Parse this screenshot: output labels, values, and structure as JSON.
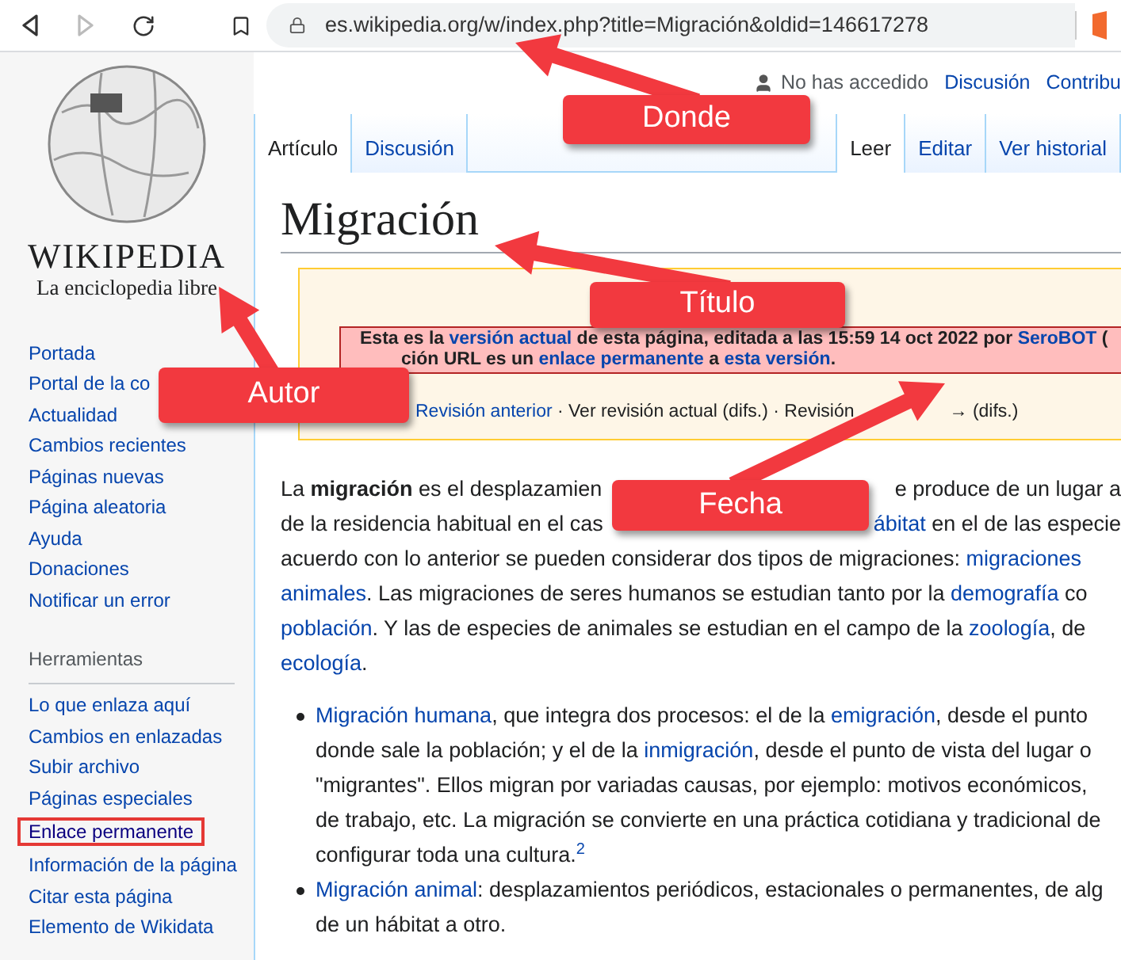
{
  "browser": {
    "forward_disabled": true,
    "url": "es.wikipedia.org/w/index.php?title=Migración&oldid=146617278"
  },
  "personal": {
    "status": "No has accedido",
    "links": [
      "Discusión",
      "Contribu"
    ]
  },
  "tabs_left": [
    {
      "label": "Artículo",
      "selected": true
    },
    {
      "label": "Discusión",
      "selected": false
    }
  ],
  "tabs_right": [
    {
      "label": "Leer",
      "selected": true
    },
    {
      "label": "Editar",
      "selected": false
    },
    {
      "label": "Ver historial",
      "selected": false
    }
  ],
  "logo": {
    "wordmark": "WIKIPEDIA",
    "tagline": "La enciclopedia libre"
  },
  "sidebar": {
    "nav": [
      {
        "label": "Portada",
        "highlighted": false
      },
      {
        "label": "Portal de la co",
        "highlighted": false
      },
      {
        "label": "Actualidad",
        "highlighted": false
      },
      {
        "label": "Cambios recientes",
        "highlighted": false
      },
      {
        "label": "Páginas nuevas",
        "highlighted": false
      },
      {
        "label": "Página aleatoria",
        "highlighted": false
      },
      {
        "label": "Ayuda",
        "highlighted": false
      },
      {
        "label": "Donaciones",
        "highlighted": false
      },
      {
        "label": "Notificar un error",
        "highlighted": false
      }
    ],
    "tools_heading": "Herramientas",
    "tools": [
      {
        "label": "Lo que enlaza aquí",
        "highlighted": false
      },
      {
        "label": "Cambios en enlazadas",
        "highlighted": false
      },
      {
        "label": "Subir archivo",
        "highlighted": false
      },
      {
        "label": "Páginas especiales",
        "highlighted": false
      },
      {
        "label": "Enlace permanente",
        "highlighted": true
      },
      {
        "label": "Información de la página",
        "highlighted": false
      },
      {
        "label": "Citar esta página",
        "highlighted": false
      },
      {
        "label": "Elemento de Wikidata",
        "highlighted": false
      }
    ]
  },
  "title": "Migración",
  "notice": {
    "lines": [
      [
        [
          {
            "kind": "text",
            "t": "Esta es la "
          },
          {
            "kind": "link",
            "t": "versión actual"
          },
          {
            "kind": "text",
            "t": " de esta página, editada a las 15:59 14 oct 2022 por "
          },
          {
            "kind": "link",
            "t": "SeroBOT"
          },
          {
            "kind": "text",
            "t": " ("
          }
        ]
      ],
      [
        [
          {
            "kind": "text",
            "t": "ción URL es un "
          },
          {
            "kind": "link",
            "t": "enlace permanente"
          },
          {
            "kind": "text",
            "t": " a "
          },
          {
            "kind": "link",
            "t": "esta versión"
          },
          {
            "kind": "text",
            "t": "."
          }
        ]
      ]
    ],
    "nav": [
      [
        {
          "kind": "link",
          "t": "Revisión anterior"
        },
        {
          "kind": "text",
          "t": " · Ver revisión actual (difs.) · Revisión"
        }
      ],
      [
        {
          "kind": "text",
          "t": "→ (difs.)"
        }
      ]
    ]
  },
  "paragraph": [
    [
      [
        {
          "kind": "text",
          "t": "La "
        },
        {
          "kind": "bold",
          "t": "migración"
        },
        {
          "kind": "text",
          "t": " es el desplazamien"
        }
      ],
      [
        {
          "kind": "text",
          "t": "e produce de un lugar a"
        }
      ]
    ],
    [
      [
        {
          "kind": "text",
          "t": "de la residencia habitual en el cas"
        }
      ],
      [
        {
          "kind": "link",
          "t": "ábitat"
        },
        {
          "kind": "text",
          "t": " en el de las especie"
        }
      ]
    ],
    [
      [
        {
          "kind": "text",
          "t": "acuerdo con lo anterior se pueden considerar dos tipos de migraciones: "
        },
        {
          "kind": "link",
          "t": "migraciones"
        }
      ]
    ],
    [
      [
        {
          "kind": "link",
          "t": "animales"
        },
        {
          "kind": "text",
          "t": ". Las migraciones de seres humanos se estudian tanto por la "
        },
        {
          "kind": "link",
          "t": "demografía"
        },
        {
          "kind": "text",
          "t": " co"
        }
      ]
    ],
    [
      [
        {
          "kind": "link",
          "t": "población"
        },
        {
          "kind": "text",
          "t": ". Y las de especies de animales se estudian en el campo de la "
        },
        {
          "kind": "link",
          "t": "zoología"
        },
        {
          "kind": "text",
          "t": ", de"
        }
      ]
    ],
    [
      [
        {
          "kind": "link",
          "t": "ecología"
        },
        {
          "kind": "text",
          "t": "."
        }
      ]
    ]
  ],
  "bullets": [
    [
      [
        [
          {
            "kind": "link",
            "t": "Migración humana"
          },
          {
            "kind": "text",
            "t": ", que integra dos procesos: el de la "
          },
          {
            "kind": "link",
            "t": "emigración"
          },
          {
            "kind": "text",
            "t": ", desde el punto"
          }
        ]
      ],
      [
        [
          {
            "kind": "text",
            "t": "donde sale la población; y el de la "
          },
          {
            "kind": "link",
            "t": "inmigración"
          },
          {
            "kind": "text",
            "t": ", desde el punto de vista del lugar o"
          }
        ]
      ],
      [
        [
          {
            "kind": "text",
            "t": "\"migrantes\". Ellos migran por variadas causas, por ejemplo: motivos económicos,"
          }
        ]
      ],
      [
        [
          {
            "kind": "text",
            "t": "de trabajo, etc. La migración se convierte en una práctica cotidiana y tradicional de"
          }
        ]
      ],
      [
        [
          {
            "kind": "text",
            "t": "configurar toda una cultura."
          },
          {
            "kind": "sup",
            "t": "2"
          }
        ]
      ]
    ],
    [
      [
        [
          {
            "kind": "link",
            "t": "Migración animal"
          },
          {
            "kind": "text",
            "t": ": desplazamientos periódicos, estacionales o permanentes, de alg"
          }
        ]
      ],
      [
        [
          {
            "kind": "text",
            "t": "de un hábitat a otro."
          }
        ]
      ]
    ]
  ],
  "callouts": [
    {
      "label": "Donde"
    },
    {
      "label": "Título"
    },
    {
      "label": "Autor"
    },
    {
      "label": "Fecha"
    }
  ]
}
